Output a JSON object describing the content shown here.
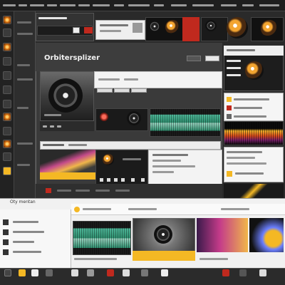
{
  "app": {
    "title": "Orbitersplizer",
    "accent": "#f4b824",
    "accent_red": "#c0291e"
  },
  "panels": {
    "bottom_header": "Oty mentan"
  },
  "icons": {
    "sidebar": [
      "eq-icon",
      "power-icon",
      "folder-icon",
      "disc-icon",
      "knob-icon",
      "mixer-icon",
      "play-icon",
      "record-icon",
      "settings-icon",
      "list-icon",
      "clock-icon",
      "fader-icon"
    ],
    "taskbar": [
      "start-icon",
      "folder-icon",
      "browser-icon",
      "music-icon",
      "video-icon",
      "mail-icon",
      "record-icon",
      "mixer-icon",
      "settings-icon",
      "chat-icon",
      "photo-icon",
      "terminal-icon",
      "note-icon"
    ]
  }
}
